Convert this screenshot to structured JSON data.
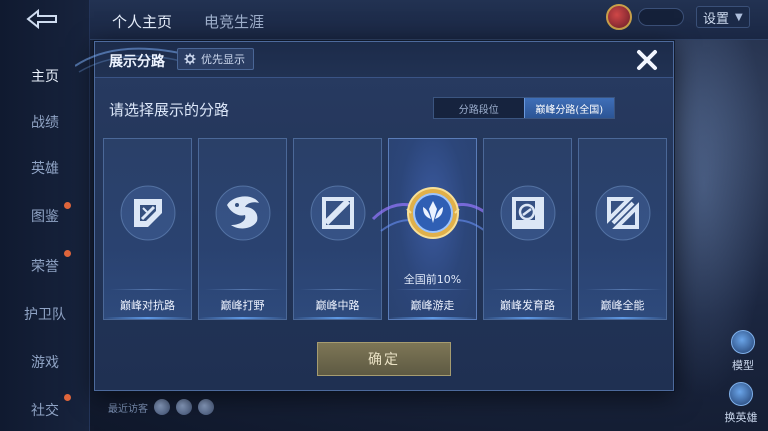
{
  "background": {
    "tabs": [
      "个人主页",
      "电竞生涯"
    ],
    "settings_label": "设置",
    "sidebar": [
      "主页",
      "战绩",
      "英雄",
      "图鉴",
      "荣誉",
      "护卫队",
      "游戏",
      "社交"
    ],
    "footer_text": "最近访客",
    "right_buttons": [
      "模型",
      "换英雄"
    ]
  },
  "modal": {
    "title": "展示分路",
    "priority_label": "优先显示",
    "prompt": "请选择展示的分路",
    "toggle": {
      "options": [
        "分路段位",
        "巅峰分路(全国)"
      ],
      "selected": 1
    },
    "cards": [
      {
        "label": "巅峰对抗路",
        "icon": "clash-lane-icon",
        "rank": ""
      },
      {
        "label": "巅峰打野",
        "icon": "jungle-dragon-icon",
        "rank": ""
      },
      {
        "label": "巅峰中路",
        "icon": "mid-lane-icon",
        "rank": ""
      },
      {
        "label": "巅峰游走",
        "icon": "roam-support-emblem-icon",
        "rank": "全国前10%"
      },
      {
        "label": "巅峰发育路",
        "icon": "farm-lane-icon",
        "rank": ""
      },
      {
        "label": "巅峰全能",
        "icon": "all-round-icon",
        "rank": ""
      }
    ],
    "selected_card": 3,
    "confirm_label": "确定"
  },
  "colors": {
    "modal_bg": "#223457",
    "accent_blue": "#3f6fb8",
    "confirm_gold": "#7d7656",
    "emblem_gold": "#e0b04a"
  }
}
